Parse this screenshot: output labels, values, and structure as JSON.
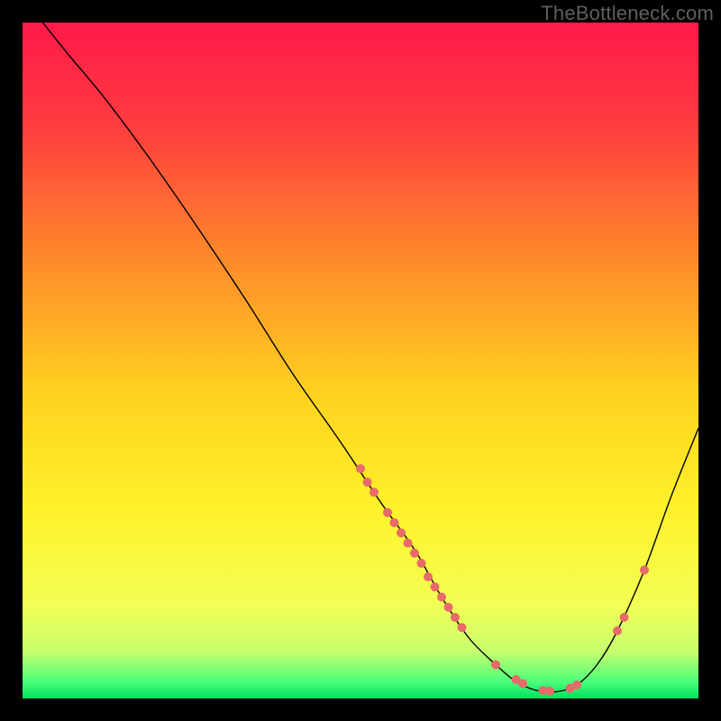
{
  "watermark": "TheBottleneck.com",
  "chart_data": {
    "type": "line",
    "title": "",
    "xlabel": "",
    "ylabel": "",
    "xlim": [
      0,
      100
    ],
    "ylim": [
      0,
      100
    ],
    "background": {
      "type": "vertical_gradient",
      "stops": [
        {
          "offset": 0.0,
          "color": "#ff1a4a"
        },
        {
          "offset": 0.15,
          "color": "#ff3b3f"
        },
        {
          "offset": 0.35,
          "color": "#ff8a2a"
        },
        {
          "offset": 0.55,
          "color": "#ffd21f"
        },
        {
          "offset": 0.72,
          "color": "#fff22a"
        },
        {
          "offset": 0.86,
          "color": "#f3ff53"
        },
        {
          "offset": 0.93,
          "color": "#c8ff6e"
        },
        {
          "offset": 0.975,
          "color": "#4dff7a"
        },
        {
          "offset": 1.0,
          "color": "#00e060"
        }
      ]
    },
    "series": [
      {
        "name": "curve",
        "color": "#000000",
        "stroke_width": 1.4,
        "points": [
          {
            "x": 3,
            "y": 100
          },
          {
            "x": 7,
            "y": 95
          },
          {
            "x": 12,
            "y": 89
          },
          {
            "x": 18,
            "y": 81
          },
          {
            "x": 25,
            "y": 71
          },
          {
            "x": 33,
            "y": 59
          },
          {
            "x": 40,
            "y": 48
          },
          {
            "x": 47,
            "y": 38
          },
          {
            "x": 53,
            "y": 29
          },
          {
            "x": 58,
            "y": 22
          },
          {
            "x": 62,
            "y": 15
          },
          {
            "x": 66,
            "y": 9
          },
          {
            "x": 70,
            "y": 5
          },
          {
            "x": 73,
            "y": 2.5
          },
          {
            "x": 76,
            "y": 1.2
          },
          {
            "x": 79,
            "y": 1.0
          },
          {
            "x": 82,
            "y": 2.0
          },
          {
            "x": 85,
            "y": 5
          },
          {
            "x": 88,
            "y": 10
          },
          {
            "x": 92,
            "y": 19
          },
          {
            "x": 96,
            "y": 30
          },
          {
            "x": 100,
            "y": 40
          }
        ]
      }
    ],
    "markers": {
      "color": "#e86a6a",
      "radius": 5,
      "points": [
        {
          "x": 50,
          "y": 34
        },
        {
          "x": 51,
          "y": 32
        },
        {
          "x": 52,
          "y": 30.5
        },
        {
          "x": 54,
          "y": 27.5
        },
        {
          "x": 55,
          "y": 26
        },
        {
          "x": 56,
          "y": 24.5
        },
        {
          "x": 57,
          "y": 23
        },
        {
          "x": 58,
          "y": 21.5
        },
        {
          "x": 59,
          "y": 20
        },
        {
          "x": 60,
          "y": 18
        },
        {
          "x": 61,
          "y": 16.5
        },
        {
          "x": 62,
          "y": 15
        },
        {
          "x": 63,
          "y": 13.5
        },
        {
          "x": 64,
          "y": 12
        },
        {
          "x": 65,
          "y": 10.5
        },
        {
          "x": 70,
          "y": 5
        },
        {
          "x": 73,
          "y": 2.8
        },
        {
          "x": 74,
          "y": 2.2
        },
        {
          "x": 77,
          "y": 1.2
        },
        {
          "x": 78,
          "y": 1.1
        },
        {
          "x": 81,
          "y": 1.5
        },
        {
          "x": 82,
          "y": 2.0
        },
        {
          "x": 88,
          "y": 10
        },
        {
          "x": 89,
          "y": 12
        },
        {
          "x": 92,
          "y": 19
        }
      ]
    }
  }
}
